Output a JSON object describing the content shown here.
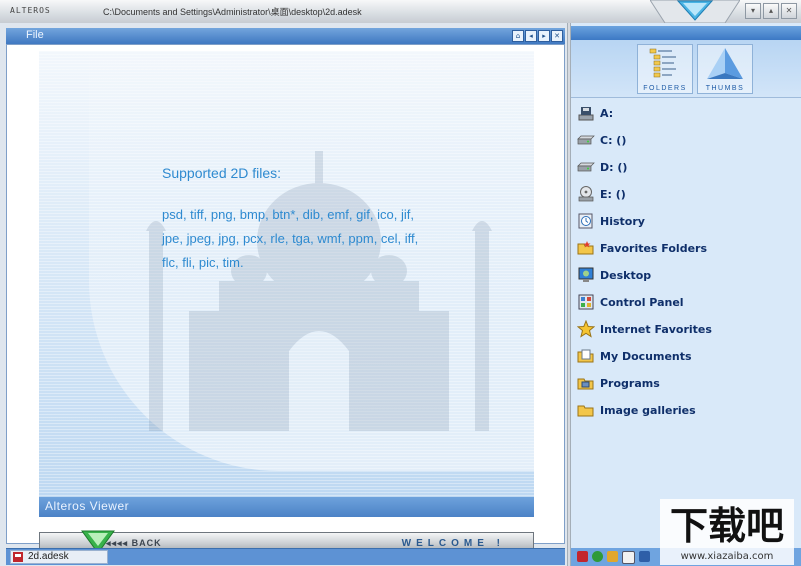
{
  "titlebar": {
    "brand": "ALTEROS",
    "path": "C:\\Documents and Settings\\Administrator\\桌面\\desktop\\2d.adesk"
  },
  "viewer_panel": {
    "title": "File",
    "info_heading": "Supported 2D files:",
    "info_lines": [
      "psd, tiff, png, bmp, btn*, dib, emf, gif, ico, jif,",
      "jpe, jpeg, jpg, pcx, rle, tga, wmf, ppm, cel, iff,",
      "flc, fli, pic, tim."
    ],
    "footer_label": "Alteros Viewer",
    "nav": {
      "arrows": "◂◂◂◂",
      "back_label": "BACK",
      "welcome": "WELCOME !"
    },
    "status_tab": "2d.adesk"
  },
  "right_panel": {
    "tabs": [
      {
        "label": "FOLDERS",
        "icon": "folders-tree-icon"
      },
      {
        "label": "THUMBS",
        "icon": "thumbs-pyramid-icon"
      }
    ],
    "items": [
      {
        "label": "A:",
        "icon": "floppy-drive-icon"
      },
      {
        "label": "C: ()",
        "icon": "hard-drive-icon"
      },
      {
        "label": "D: ()",
        "icon": "hard-drive-icon"
      },
      {
        "label": "E: ()",
        "icon": "cd-drive-icon"
      },
      {
        "label": "History",
        "icon": "history-icon"
      },
      {
        "label": "Favorites Folders",
        "icon": "favorites-folder-icon"
      },
      {
        "label": "Desktop",
        "icon": "desktop-icon"
      },
      {
        "label": "Control Panel",
        "icon": "control-panel-icon"
      },
      {
        "label": "Internet Favorites",
        "icon": "star-icon"
      },
      {
        "label": "My Documents",
        "icon": "documents-icon"
      },
      {
        "label": "Programs",
        "icon": "programs-icon"
      },
      {
        "label": "Image galleries",
        "icon": "folder-icon"
      }
    ],
    "watermark_text": "下载吧",
    "watermark_url": "www.xiazaiba.com"
  },
  "colors": {
    "accent": "#3f78c1",
    "info_text": "#2e8ad0",
    "item_text": "#0f2f6a"
  }
}
